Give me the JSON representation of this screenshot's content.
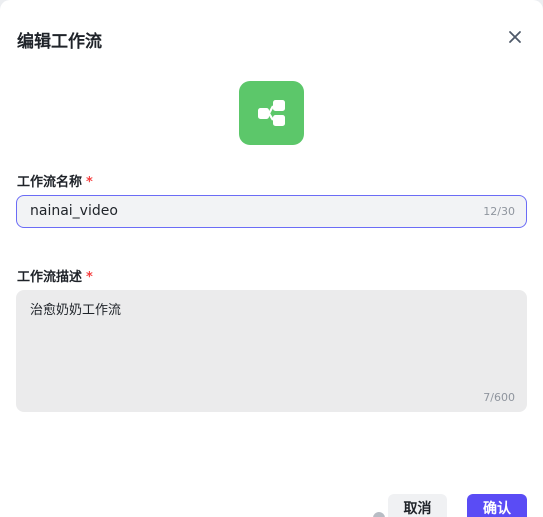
{
  "dialog": {
    "title": "编辑工作流",
    "close_icon": "close-icon"
  },
  "app_icon": {
    "icon": "workflow-icon",
    "color": "#5cc76a"
  },
  "name_field": {
    "label": "工作流名称",
    "required_mark": "*",
    "value": "nainai_video",
    "counter": "12/30"
  },
  "desc_field": {
    "label": "工作流描述",
    "required_mark": "*",
    "value": "治愈奶奶工作流",
    "counter": "7/600"
  },
  "footer": {
    "cancel_label": "取消",
    "confirm_label": "确认",
    "confirm_color": "#5a4cf5"
  }
}
